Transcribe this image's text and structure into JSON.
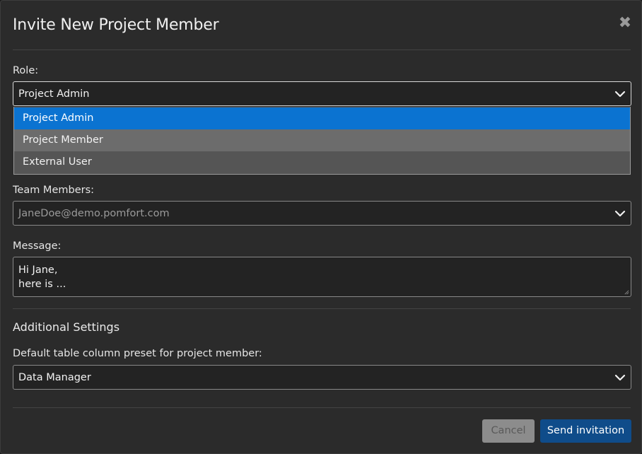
{
  "dialog": {
    "title": "Invite New Project Member",
    "close_icon": "close-icon"
  },
  "role": {
    "label": "Role:",
    "selected": "Project Admin",
    "options": [
      "Project Admin",
      "Project Member",
      "External User"
    ],
    "open": true
  },
  "team_members": {
    "label": "Team Members:",
    "placeholder": "JaneDoe@demo.pomfort.com"
  },
  "message": {
    "label": "Message:",
    "value": "Hi Jane,\nhere is ..."
  },
  "additional_settings": {
    "title": "Additional Settings",
    "preset_label": "Default table column preset for project member:",
    "preset_value": "Data Manager"
  },
  "buttons": {
    "cancel": "Cancel",
    "send": "Send invitation"
  },
  "colors": {
    "selected_option": "#0b73d1",
    "primary_button": "#0f4c8a"
  }
}
